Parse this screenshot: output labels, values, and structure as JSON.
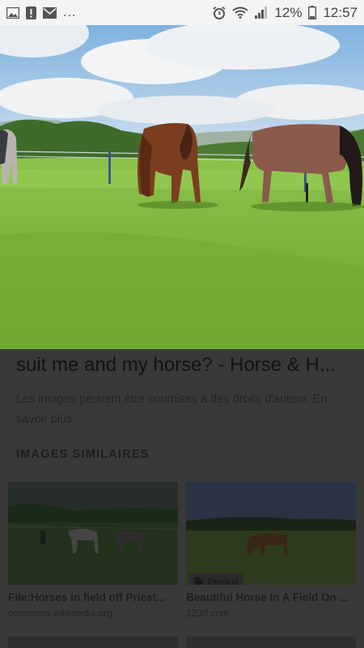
{
  "status_bar": {
    "overflow": "...",
    "battery_percent": "12%",
    "time": "12:57",
    "left_icons": [
      "image-icon",
      "alert-icon",
      "mail-icon"
    ],
    "right_icons": [
      "alarm-icon",
      "wifi-icon",
      "signal-icon",
      "battery-icon"
    ]
  },
  "result": {
    "title": "suit me and my horse? - Horse & H...",
    "copyright": "Les images peuvent être soumises à des droits d'auteur. En savoir plus"
  },
  "similar": {
    "heading": "IMAGES SIMILAIRES",
    "items": [
      {
        "caption": "File:Horses in field off Priest...",
        "source": "commons.wikimedia.org"
      },
      {
        "caption": "Beautiful Horse In A Field On ...",
        "source": "123rf.com",
        "badge": "Produit"
      }
    ]
  },
  "colors": {
    "status_bar_bg": "#f4f4f4",
    "sheet_dim": "#393939",
    "grass": "#79b23a",
    "sky": "#a9cbe8"
  }
}
